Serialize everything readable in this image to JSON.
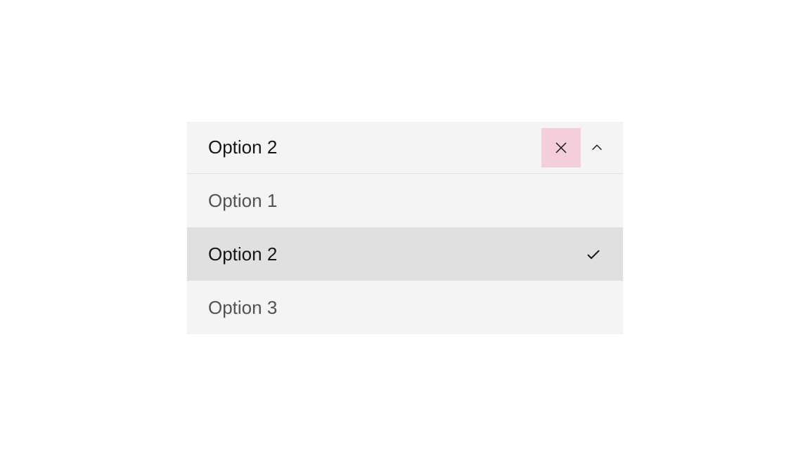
{
  "dropdown": {
    "selected_value": "Option 2",
    "selected_index": 1,
    "options": [
      {
        "label": "Option 1"
      },
      {
        "label": "Option 2"
      },
      {
        "label": "Option 3"
      }
    ],
    "colors": {
      "clear_highlight": "#f4cedb",
      "background": "#f4f4f4",
      "selected_background": "#e0e0e0"
    }
  }
}
